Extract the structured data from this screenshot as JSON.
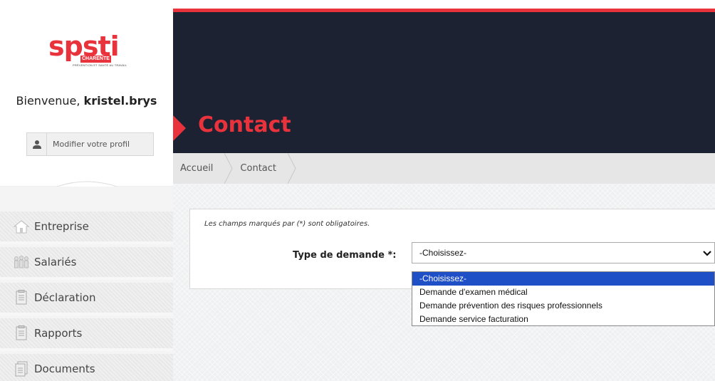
{
  "sidebar": {
    "logo_word": "spsti",
    "logo_badge": "CHARENTE",
    "logo_tagline": "PRÉVENTION ET SANTÉ AU TRAVAIL",
    "welcome_prefix": "Bienvenue, ",
    "username": "kristel.brys",
    "profile_button": "Modifier votre profil",
    "nav": [
      {
        "label": "Entreprise",
        "icon": "home-icon"
      },
      {
        "label": "Salariés",
        "icon": "people-icon"
      },
      {
        "label": "Déclaration",
        "icon": "document-icon"
      },
      {
        "label": "Rapports",
        "icon": "report-icon"
      },
      {
        "label": "Documents",
        "icon": "documents-icon"
      }
    ]
  },
  "header": {
    "title": "Contact"
  },
  "breadcrumb": [
    "Accueil",
    "Contact"
  ],
  "form": {
    "required_note": "Les champs marqués par (*) sont obligatoires.",
    "type_label": "Type de demande *:",
    "type_value": "-Choisissez-",
    "options": [
      "-Choisissez-",
      "Demande d'examen médical",
      "Demande prévention des risques professionnels",
      "Demande service facturation"
    ],
    "selected_index": 0
  },
  "colors": {
    "accent": "#e8333d",
    "header_bg": "#1d2233",
    "selected_option": "#1f4fc7"
  }
}
